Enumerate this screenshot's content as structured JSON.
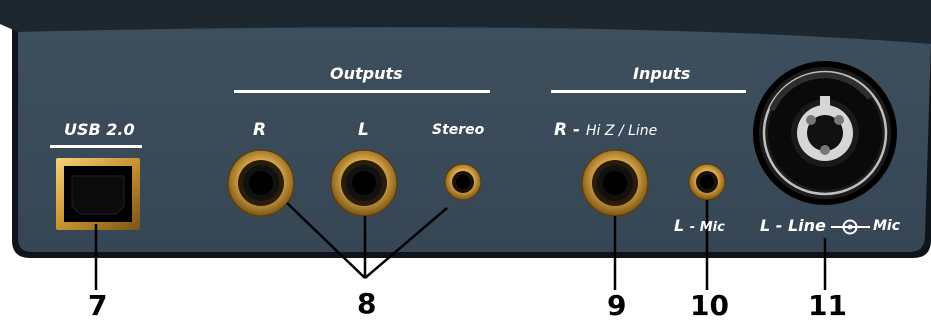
{
  "colors": {
    "panel": "#3a4a58",
    "panel_top": "#1f2a34",
    "rim": "#0e141a",
    "jack_gold": "#d9a84a",
    "jack_gold_dark": "#8a6320",
    "label_text": "#ffffff",
    "callout": "#000000"
  },
  "sections": {
    "outputs": "Outputs",
    "inputs": "Inputs"
  },
  "labels": {
    "usb": "USB 2.0",
    "out_r": "R",
    "out_l": "L",
    "out_stereo": "Stereo",
    "in_r_main": "R -",
    "in_r_sub": "Hi Z / Line",
    "in_l_mic_main": "L",
    "in_l_mic_sub": "- Mic",
    "combo_main": "L - Line",
    "combo_sub": "Mic"
  },
  "callouts": {
    "usb": "7",
    "outputs": "8",
    "hiz_input": "9",
    "mic_input": "10",
    "combo_input": "11"
  }
}
